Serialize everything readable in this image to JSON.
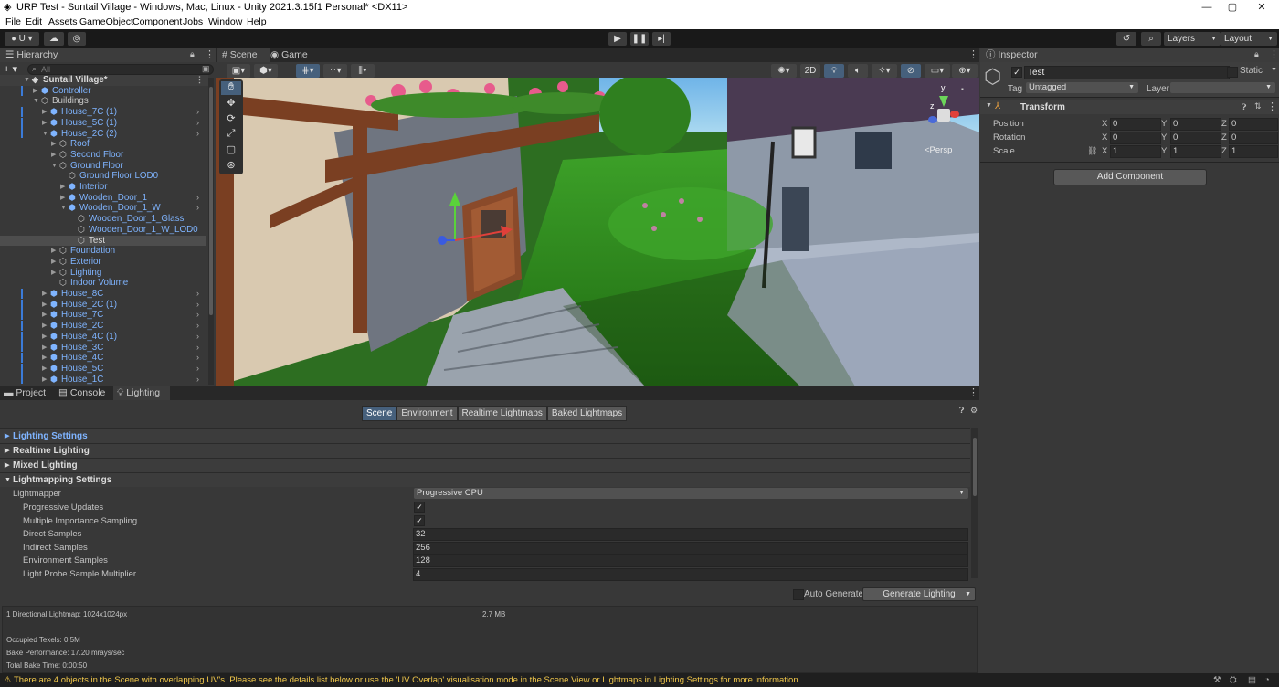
{
  "window": {
    "title": "URP Test - Suntail Village - Windows, Mac, Linux - Unity 2021.3.15f1 Personal* <DX11>",
    "minimize": "—",
    "maximize": "▢",
    "close": "✕"
  },
  "menu": [
    "File",
    "Edit",
    "Assets",
    "GameObject",
    "Component",
    "Jobs",
    "Window",
    "Help"
  ],
  "toolbar": {
    "account": "U ▾",
    "layers": "Layers",
    "layout": "Layout"
  },
  "hierarchy": {
    "title": "Hierarchy",
    "search_placeholder": "All",
    "add": "+ ▾",
    "rows": [
      {
        "label": "Suntail Village*"
      },
      {
        "label": "Controller"
      },
      {
        "label": "Buildings"
      },
      {
        "label": "House_7C (1)"
      },
      {
        "label": "House_5C (1)"
      },
      {
        "label": "House_2C (2)"
      },
      {
        "label": "Roof"
      },
      {
        "label": "Second Floor"
      },
      {
        "label": "Ground Floor"
      },
      {
        "label": "Ground Floor LOD0"
      },
      {
        "label": "Interior"
      },
      {
        "label": "Wooden_Door_1"
      },
      {
        "label": "Wooden_Door_1_W"
      },
      {
        "label": "Wooden_Door_1_Glass"
      },
      {
        "label": "Wooden_Door_1_W_LOD0"
      },
      {
        "label": "Test"
      },
      {
        "label": "Foundation"
      },
      {
        "label": "Exterior"
      },
      {
        "label": "Lighting"
      },
      {
        "label": "Indoor Volume"
      },
      {
        "label": "House_8C"
      },
      {
        "label": "House_2C (1)"
      },
      {
        "label": "House_7C"
      },
      {
        "label": "House_2C"
      },
      {
        "label": "House_4C (1)"
      },
      {
        "label": "House_3C"
      },
      {
        "label": "House_4C"
      },
      {
        "label": "House_5C"
      },
      {
        "label": "House_1C"
      }
    ]
  },
  "scene": {
    "tab_scene": "Scene",
    "tab_game": "Game",
    "persp": "<Persp",
    "mode_2d": "2D",
    "gizmo_y": "y",
    "gizmo_z": "z"
  },
  "inspector": {
    "title": "Inspector",
    "object_name": "Test",
    "static_label": "Static",
    "tag_label": "Tag",
    "tag_value": "Untagged",
    "layer_label": "Layer",
    "layer_value": "",
    "transform": "Transform",
    "position_label": "Position",
    "rotation_label": "Rotation",
    "scale_label": "Scale",
    "x": "X",
    "y": "Y",
    "z": "Z",
    "position": [
      "0",
      "0",
      "0"
    ],
    "rotation": [
      "0",
      "0",
      "0"
    ],
    "scale": [
      "1",
      "1",
      "1"
    ],
    "add_component": "Add Component"
  },
  "bottom": {
    "tabs": [
      "Project",
      "Console",
      "Lighting"
    ],
    "subtabs": [
      "Scene",
      "Environment",
      "Realtime Lightmaps",
      "Baked Lightmaps"
    ],
    "sections": [
      "Lighting Settings",
      "Realtime Lighting",
      "Mixed Lighting",
      "Lightmapping Settings"
    ],
    "lightmapper_label": "Lightmapper",
    "lightmapper_value": "Progressive CPU",
    "settings": [
      {
        "label": "Progressive Updates",
        "value": "✓"
      },
      {
        "label": "Multiple Importance Sampling",
        "value": "✓"
      },
      {
        "label": "Direct Samples",
        "value": "32"
      },
      {
        "label": "Indirect Samples",
        "value": "256"
      },
      {
        "label": "Environment Samples",
        "value": "128"
      },
      {
        "label": "Light Probe Sample Multiplier",
        "value": "4"
      }
    ],
    "auto_generate": "Auto Generate",
    "generate": "Generate Lighting",
    "stats": {
      "lightmap": "1 Directional Lightmap: 1024x1024px",
      "size": "2.7 MB",
      "texels": "Occupied Texels: 0.5M",
      "perf": "Bake Performance: 17.20 mrays/sec",
      "time": "Total Bake Time: 0:00:50"
    }
  },
  "status": "⚠ There are 4 objects in the Scene with overlapping UV's. Please see the details list below or use the 'UV Overlap' visualisation mode in the Scene View or Lightmaps in Lighting Settings for more information."
}
